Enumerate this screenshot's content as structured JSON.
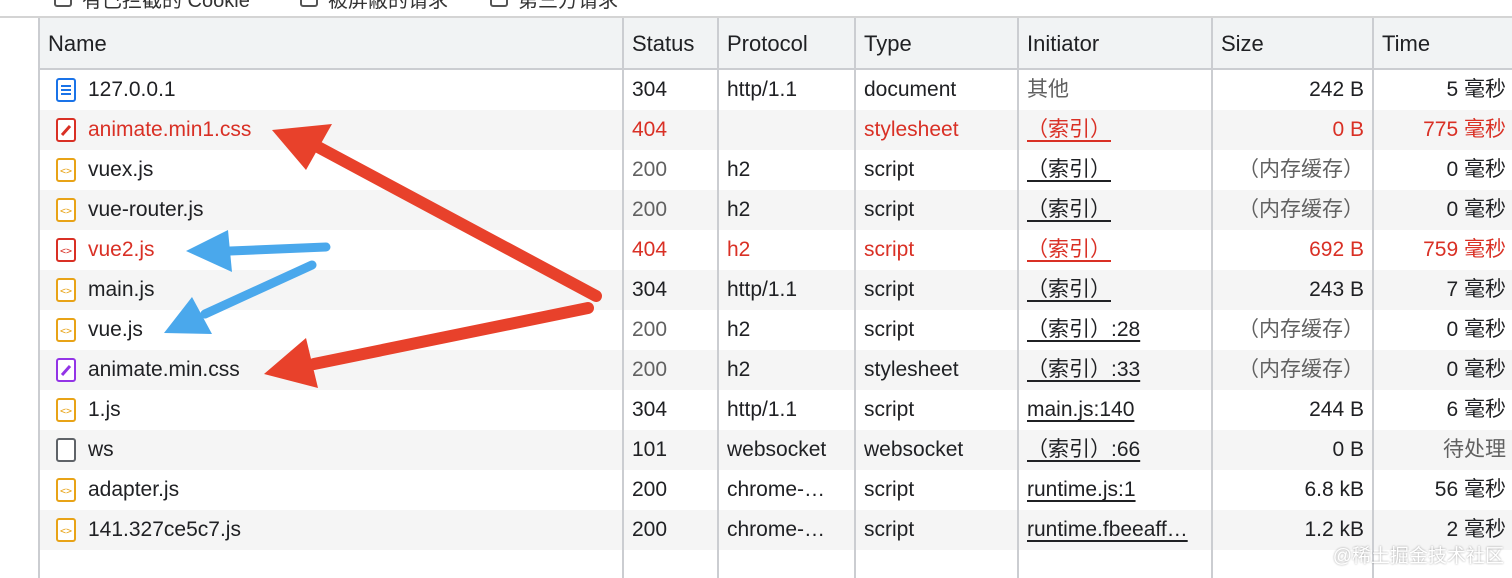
{
  "filters": {
    "items": [
      {
        "label": "有已拦截的 Cookie"
      },
      {
        "label": "被屏蔽的请求"
      },
      {
        "label": "第三方请求"
      }
    ]
  },
  "table": {
    "columns": {
      "name": "Name",
      "status": "Status",
      "protocol": "Protocol",
      "type": "Type",
      "initiator": "Initiator",
      "size": "Size",
      "time": "Time"
    },
    "rows": [
      {
        "name": "127.0.0.1",
        "icon": "document-icon",
        "status": "304",
        "protocol": "http/1.1",
        "type": "document",
        "initiator": "其他",
        "size": "242 B",
        "time": "5 毫秒"
      },
      {
        "name": "animate.min1.css",
        "icon": "css-file-icon",
        "status": "404",
        "protocol": "",
        "type": "stylesheet",
        "initiator": "（索引）",
        "size": "0 B",
        "time": "775 毫秒"
      },
      {
        "name": "vuex.js",
        "icon": "script-file-icon",
        "status": "200",
        "protocol": "h2",
        "type": "script",
        "initiator": "（索引）",
        "size": "（内存缓存）",
        "time": "0 毫秒"
      },
      {
        "name": "vue-router.js",
        "icon": "script-file-icon",
        "status": "200",
        "protocol": "h2",
        "type": "script",
        "initiator": "（索引）",
        "size": "（内存缓存）",
        "time": "0 毫秒"
      },
      {
        "name": "vue2.js",
        "icon": "script-file-icon",
        "status": "404",
        "protocol": "h2",
        "type": "script",
        "initiator": "（索引）",
        "size": "692 B",
        "time": "759 毫秒"
      },
      {
        "name": "main.js",
        "icon": "script-file-icon",
        "status": "304",
        "protocol": "http/1.1",
        "type": "script",
        "initiator": "（索引）",
        "size": "243 B",
        "time": "7 毫秒"
      },
      {
        "name": "vue.js",
        "icon": "script-file-icon",
        "status": "200",
        "protocol": "h2",
        "type": "script",
        "initiator": "（索引）:28",
        "size": "（内存缓存）",
        "time": "0 毫秒"
      },
      {
        "name": "animate.min.css",
        "icon": "css-file-icon",
        "status": "200",
        "protocol": "h2",
        "type": "stylesheet",
        "initiator": "（索引）:33",
        "size": "（内存缓存）",
        "time": "0 毫秒"
      },
      {
        "name": "1.js",
        "icon": "script-file-icon",
        "status": "304",
        "protocol": "http/1.1",
        "type": "script",
        "initiator": "main.js:140",
        "size": "244 B",
        "time": "6 毫秒"
      },
      {
        "name": "ws",
        "icon": "websocket-icon",
        "status": "101",
        "protocol": "websocket",
        "type": "websocket",
        "initiator": "（索引）:66",
        "size": "0 B",
        "time": "待处理"
      },
      {
        "name": "adapter.js",
        "icon": "script-file-icon",
        "status": "200",
        "protocol": "chrome-…",
        "type": "script",
        "initiator": "runtime.js:1",
        "size": "6.8 kB",
        "time": "56 毫秒"
      },
      {
        "name": "141.327ce5c7.js",
        "icon": "script-file-icon",
        "status": "200",
        "protocol": "chrome-…",
        "type": "script",
        "initiator": "runtime.fbeeaff…",
        "size": "1.2 kB",
        "time": "2 毫秒"
      }
    ]
  },
  "colors": {
    "error_text": "#d93025",
    "red_arrow": "#e8412b",
    "blue_arrow": "#4aa8ec",
    "doc_icon": "#1a73e8",
    "css_error_icon": "#d93025",
    "css_icon": "#9334e6",
    "script_icon": "#e8a317"
  },
  "watermark": "@稀土掘金技术社区"
}
